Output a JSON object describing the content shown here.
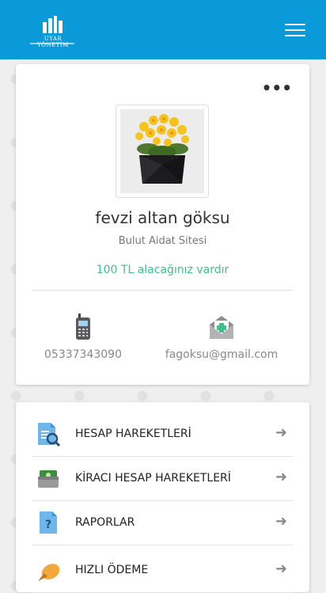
{
  "header": {
    "logo_text": "UYAR YÖNETİM",
    "menu_icon": "hamburger-menu-icon",
    "color": "#0a9ad9"
  },
  "profile": {
    "more_icon": "more-dots-icon",
    "name": "fevzi altan göksu",
    "site": "Bulut Aidat Sitesi",
    "balance": "100 TL alacağınız vardır",
    "balance_color": "#3cc08a",
    "phone": "05337343090",
    "email": "fagoksu@gmail.com"
  },
  "menu": {
    "items": [
      {
        "label": "HESAP HAREKETLERİ",
        "icon": "account-search-icon"
      },
      {
        "label": "KİRACI HESAP HAREKETLERİ",
        "icon": "money-icon"
      },
      {
        "label": "RAPORLAR",
        "icon": "report-icon"
      },
      {
        "label": "HIZLI ÖDEME",
        "icon": "fast-payment-icon"
      }
    ]
  }
}
